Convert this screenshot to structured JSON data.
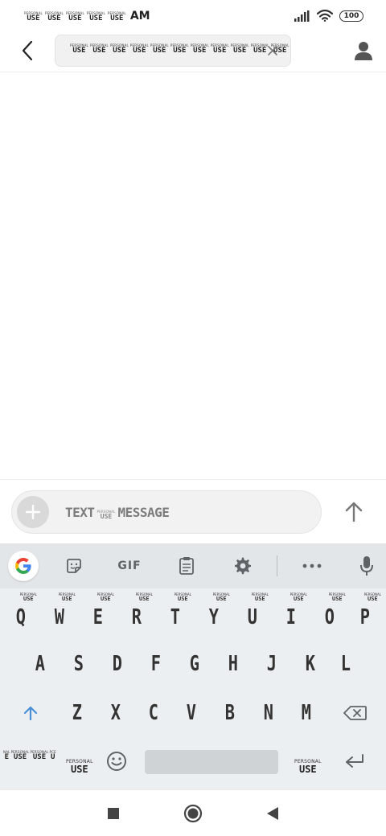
{
  "status_bar": {
    "time_words": [
      "USE",
      "USE",
      "USE",
      "USE",
      "USE"
    ],
    "time_word_caption": "PERSONAL",
    "time_suffix": "AM",
    "battery": "100"
  },
  "header": {
    "recipient_words": [
      "USE",
      "USE",
      "USE",
      "USE",
      "USE",
      "USE",
      "USE",
      "USE",
      "USE",
      "USE",
      "USE"
    ],
    "recipient_word_caption": "PERSONAL"
  },
  "compose": {
    "placeholder_left": "TEXT",
    "placeholder_caption": "PERSONAL",
    "placeholder_mid": "USE",
    "placeholder_right": "MESSAGE"
  },
  "keyboard": {
    "toolbar": {
      "gif_label": "GIF"
    },
    "hint_caption": "PERSONAL",
    "hint_word": "USE",
    "row1": [
      "Q",
      "W",
      "E",
      "R",
      "T",
      "Y",
      "U",
      "I",
      "O",
      "P"
    ],
    "row2": [
      "A",
      "S",
      "D",
      "F",
      "G",
      "H",
      "J",
      "K",
      "L"
    ],
    "row3": [
      "Z",
      "X",
      "C",
      "V",
      "B",
      "N",
      "M"
    ],
    "symbols_words": [
      "E",
      "USE",
      "USE",
      "U"
    ],
    "symbols_captions": [
      "NAL",
      "PERSONAL",
      "PERSONAL",
      "PCE"
    ],
    "personal_use_caption": "PERSONAL",
    "personal_use_word": "USE"
  },
  "colors": {
    "accent": "#4a90d9",
    "keyboard_bg": "#eceff1",
    "toolbar_bg": "#e3e6e8"
  }
}
